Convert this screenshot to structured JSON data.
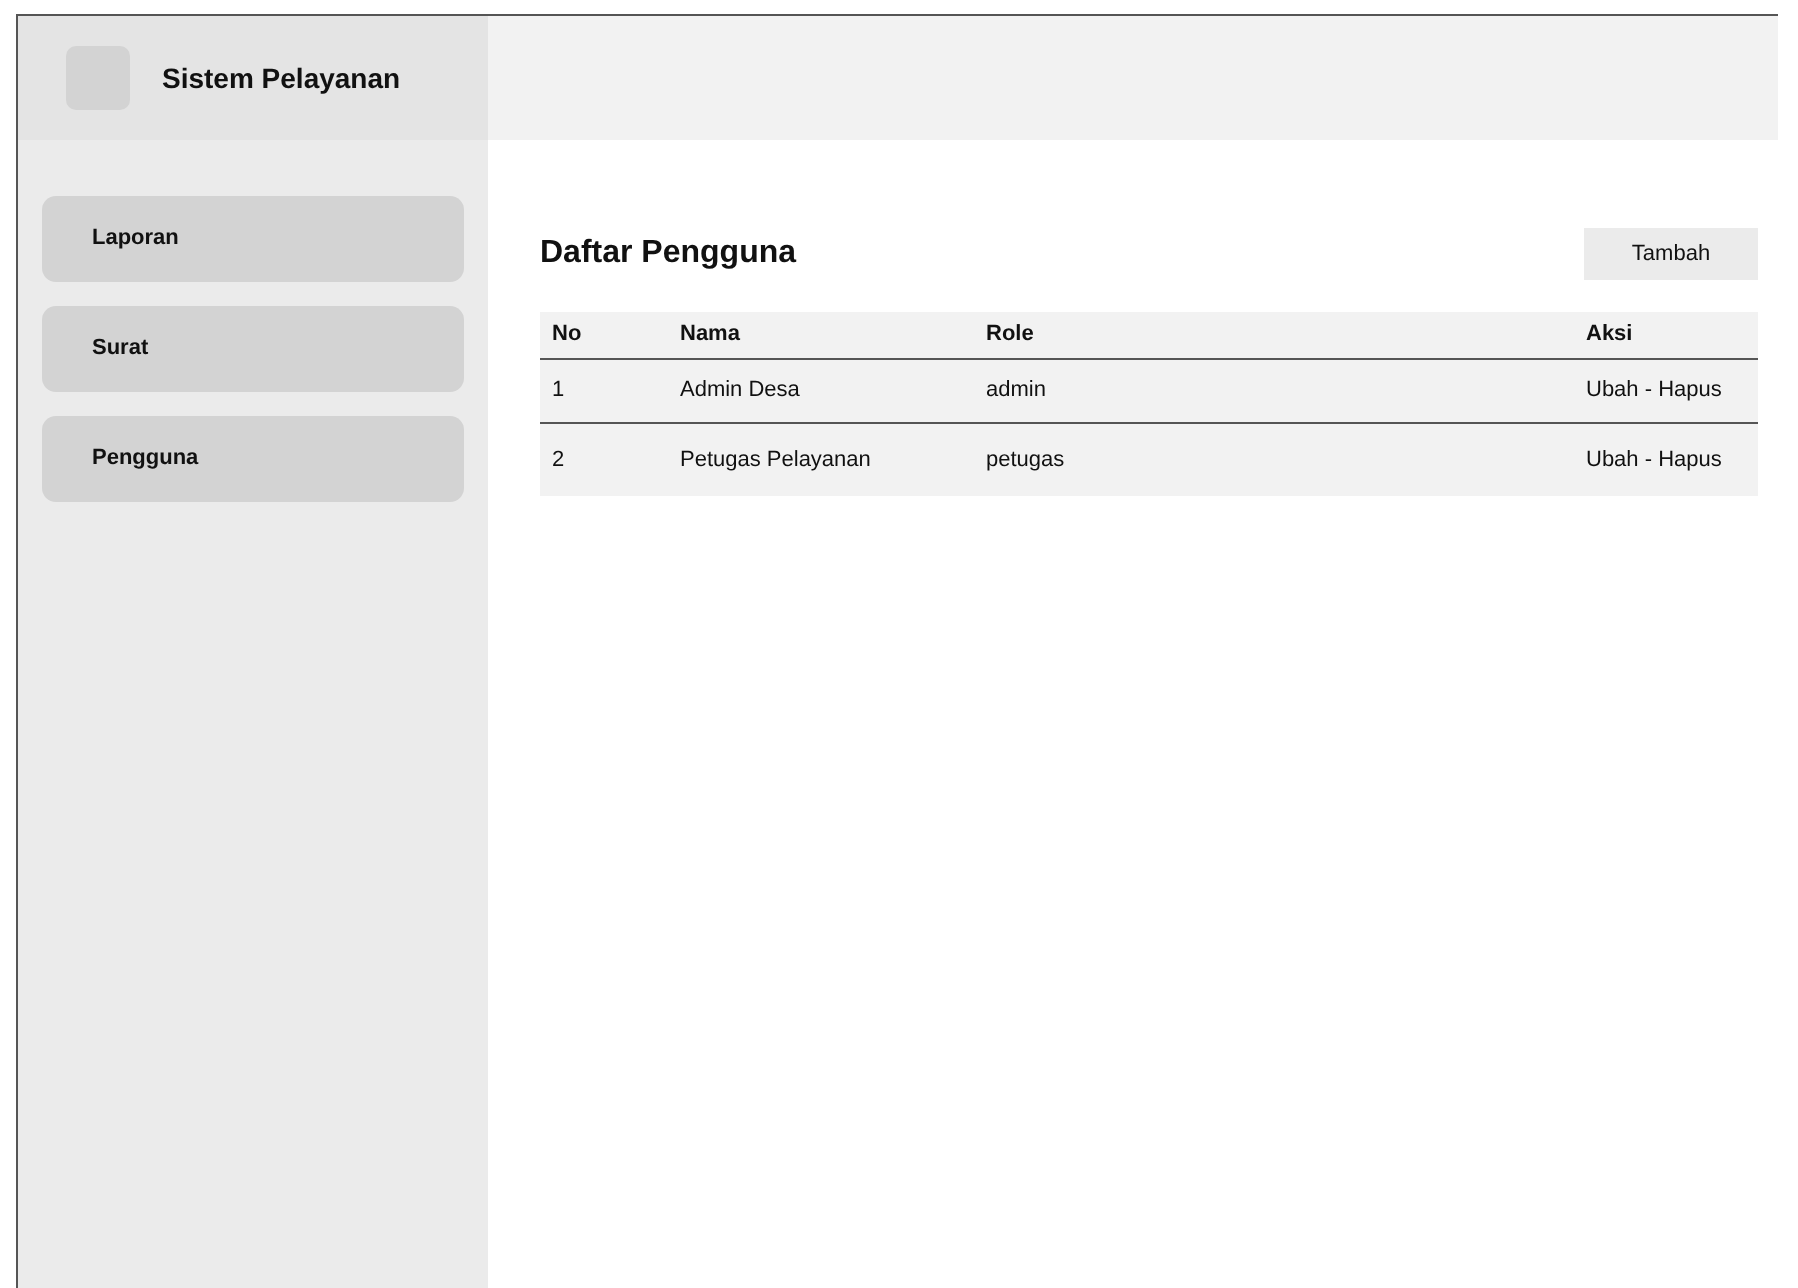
{
  "app": {
    "title": "Sistem Pelayanan"
  },
  "sidebar": {
    "items": [
      {
        "label": "Laporan"
      },
      {
        "label": "Surat"
      },
      {
        "label": "Pengguna"
      }
    ]
  },
  "page": {
    "title": "Daftar Pengguna",
    "add_button": "Tambah"
  },
  "table": {
    "columns": [
      "No",
      "Nama",
      "Role",
      "Aksi"
    ],
    "rows": [
      [
        "1",
        "Admin Desa",
        "admin",
        "Ubah - Hapus"
      ],
      [
        "2",
        "Petugas Pelayanan",
        "petugas",
        "Ubah - Hapus"
      ]
    ]
  }
}
